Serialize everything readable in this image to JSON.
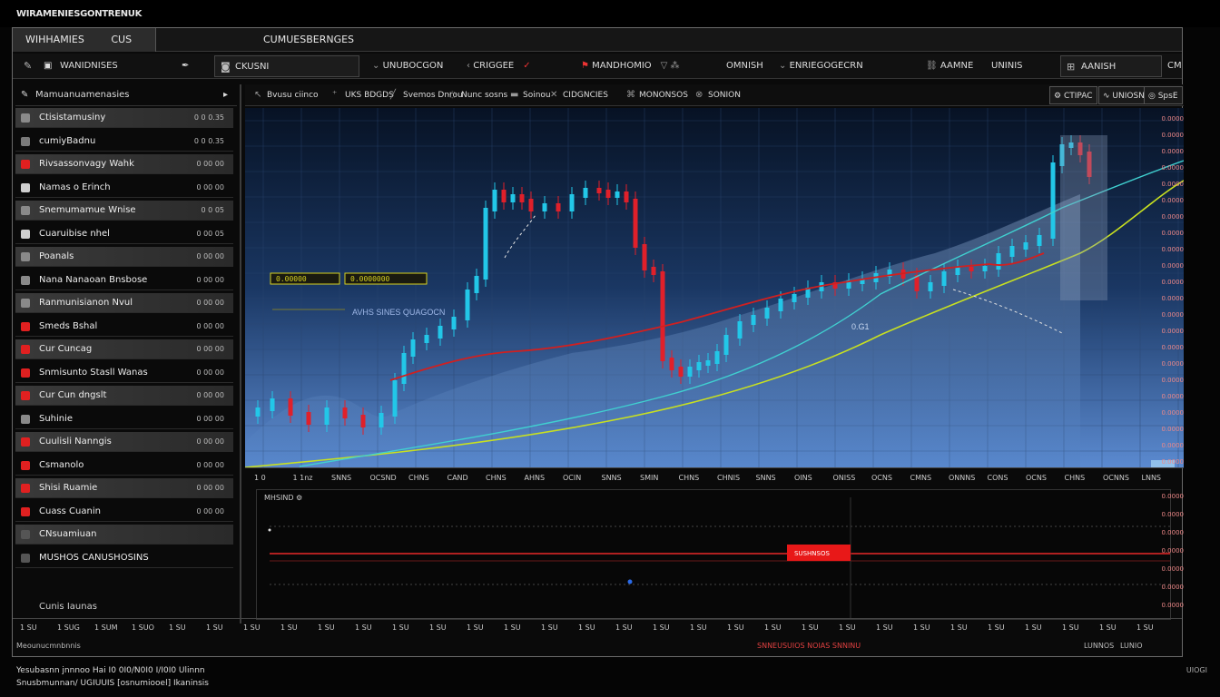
{
  "app": {
    "title": "WIRAMENIESGONTRENUK"
  },
  "tabs": [
    {
      "label": "WIHHAMIES",
      "sub": "CUS"
    },
    {
      "label": "CUMUESBERNGES"
    }
  ],
  "toolbar": {
    "symbol": "WANIDNISES",
    "layout": "CKUSNI",
    "items": [
      "UNUBOCGON",
      "CRIGGEE",
      "MANDHOMIO",
      "OMNISH",
      "ENRIEGOGECRN",
      "AAMNE",
      "UNINIS",
      "AANISH"
    ],
    "close": "CM"
  },
  "sidebar": {
    "header": "Mamuanuamenasies",
    "items": [
      {
        "label": "Ctisistamusiny",
        "value": "0 0 0.35",
        "color": "#8a8a8a"
      },
      {
        "label": "cumiyBadnu",
        "value": "0 0 0.35",
        "color": "#7a7a7a"
      },
      {
        "label": "Rivsassonvagy Wahk",
        "value": "0 00 00",
        "color": "#e02020"
      },
      {
        "label": "Namas o Erinch",
        "value": "0 00 00",
        "color": "#cfcfcf"
      },
      {
        "label": "Snemumamue Wnise",
        "value": "0 0 05",
        "color": "#8a8a8a"
      },
      {
        "label": "Cuaruibise  nhel",
        "value": "0 00 05",
        "color": "#cfcfcf"
      },
      {
        "label": "Poanals",
        "value": "0 00 00",
        "color": "#8a8a8a"
      },
      {
        "label": "Nana Nanaoan Bnsbose",
        "value": "0 00 00",
        "color": "#8a8a8a"
      },
      {
        "label": "Ranmunisianon Nvul",
        "value": "0 00 00",
        "color": "#8a8a8a"
      },
      {
        "label": "Smeds Bshal",
        "value": "0 00 00",
        "color": "#e02020"
      },
      {
        "label": "Cur Cuncag",
        "value": "0 00 00",
        "color": "#e02020"
      },
      {
        "label": "Snmisunto Stasll Wanas",
        "value": "0 00 00",
        "color": "#e02020"
      },
      {
        "label": "Cur Cun dngslt",
        "value": "0 00 00",
        "color": "#e02020"
      },
      {
        "label": "Suhinie",
        "value": "0 00 00",
        "color": "#8a8a8a"
      },
      {
        "label": "Cuulisli Nanngis",
        "value": "0 00 00",
        "color": "#e02020"
      },
      {
        "label": "Csmanolo",
        "value": "0 00 00",
        "color": "#e02020"
      },
      {
        "label": "Shisi Ruamie",
        "value": "0 00 00",
        "color": "#e02020"
      },
      {
        "label": "Cuass Cuanin",
        "value": "0 00 00",
        "color": "#e02020"
      },
      {
        "label": "CNsuamiuan",
        "value": "",
        "color": "#555555"
      },
      {
        "label": "MUSHOS CANUSHOSINS",
        "value": "",
        "color": "#555555"
      }
    ],
    "footer": "Cunis Iaunas"
  },
  "chart_tools": {
    "items": [
      "Bvusu ciinco",
      "UKS BDGDS",
      "Svemos Dnrou",
      "Nunc sosns",
      "Soinou",
      "CIDGNCIES",
      "MONONSOS",
      "SONION"
    ],
    "right": [
      "CTIPAC",
      "UNIOSN",
      "SpsE"
    ]
  },
  "chart": {
    "annotation": "AVHS SINES QUAGOCN",
    "mid_label": "0.G1",
    "tag_left": "0.00000",
    "tag_right": "0.0000000",
    "colors": {
      "up": "#22c7e8",
      "down": "#e0202a",
      "ma_fast": "#d02020",
      "ma_slow": "#c8e020",
      "ma_mid": "#40d0d0",
      "tag": "#d6d020"
    }
  },
  "xaxis": [
    "1 0",
    "1 1nz",
    "SNNS",
    "OCSND",
    "CHNS",
    "CAND",
    "CHNS",
    "AHNS",
    "OCIN",
    "SNNS",
    "SMIN",
    "CHNS",
    "CHNIS",
    "SNNS",
    "OINS",
    "ONISS",
    "OCNS",
    "CMNS",
    "ONNNS",
    "CONS",
    "OCNS",
    "CHNS",
    "OCNNS",
    "LNNS"
  ],
  "yaxis": [
    "0.0000",
    "0.0000",
    "0.0000",
    "0.0000",
    "0.0000",
    "0.0000",
    "0.0000",
    "0.0000",
    "0.0000",
    "0.0000",
    "0.0000",
    "0.0000",
    "0.0000",
    "0.0000",
    "0.0000",
    "0.0000",
    "0.0000",
    "0.0000",
    "0.0000",
    "0.0000",
    "0.0000",
    "0.0000"
  ],
  "indicator": {
    "title": "MHSIND",
    "value_label": "SUSHNSOS"
  },
  "bottom_bar": [
    "1 SU",
    "1 SUG",
    "1 SUM",
    "1 SUO",
    "1 SU",
    "1 SU",
    "1 SU",
    "1 SU",
    "1 SU",
    "1 SU",
    "1 SU",
    "1 SU",
    "1 SU",
    "1 SU",
    "1 SU",
    "1 SU",
    "1 SU",
    "1 SU",
    "1 SU",
    "1 SU",
    "1 SU",
    "1 SU",
    "1 SU",
    "1 SU",
    "1 SU",
    "1 SU",
    "1 SU",
    "1 SU",
    "1 SU",
    "1 SU",
    "1 SU"
  ],
  "bottom_bar2": [
    "Meounucmnbnnis",
    "SNNEUSUIOS NOIAS SNNINU",
    "LUNNOS",
    "LUNIO"
  ],
  "footer": {
    "line1": "Yesubasnn jnnnoo  Hai  I0 0I0/N0I0 I/I0I0 Ulinnn",
    "line2": "Snusbmunnan/ UGIUUIS  [osnumiooel]  Ikaninsis",
    "right": "UIOGI"
  }
}
